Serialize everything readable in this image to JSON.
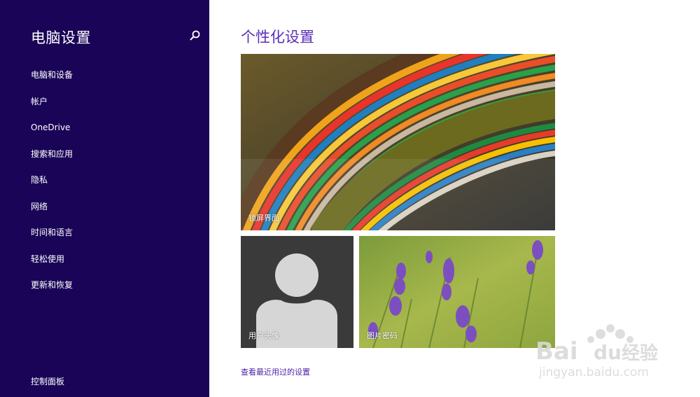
{
  "sidebar": {
    "title": "电脑设置",
    "items": [
      {
        "label": "电脑和设备"
      },
      {
        "label": "帐户"
      },
      {
        "label": "OneDrive"
      },
      {
        "label": "搜索和应用"
      },
      {
        "label": "隐私"
      },
      {
        "label": "网络"
      },
      {
        "label": "时间和语言"
      },
      {
        "label": "轻松使用"
      },
      {
        "label": "更新和恢复"
      }
    ],
    "control_panel": "控制面板",
    "search_icon": "search-icon"
  },
  "main": {
    "title": "个性化设置",
    "tiles": {
      "lock_screen": "锁屏界面",
      "account_picture": "用户头像",
      "picture_password": "图片密码"
    },
    "recent_link": "查看最近用过的设置"
  },
  "watermark": {
    "brand": "Baidu经验",
    "url": "jingyan.baidu.com"
  },
  "colors": {
    "sidebar_bg": "#1a0457",
    "accent": "#5b2fb8",
    "link": "#4b1fa8"
  }
}
